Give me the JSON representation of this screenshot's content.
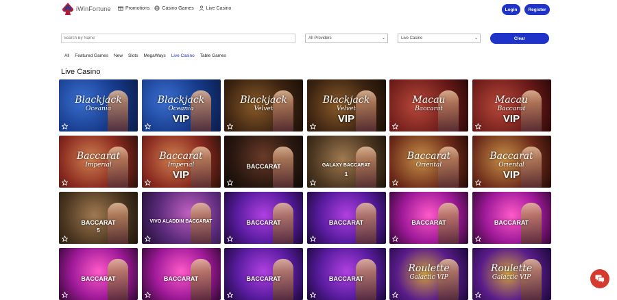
{
  "nav": {
    "logo_text": "iWinFortune",
    "links": [
      {
        "label": "Promotions",
        "icon": "gift-icon"
      },
      {
        "label": "Casino Games",
        "icon": "globe-icon"
      },
      {
        "label": "Live Casino",
        "icon": "person-icon"
      }
    ],
    "login_label": "Login",
    "register_label": "Register"
  },
  "filters": {
    "search_placeholder": "Search By Name",
    "providers_value": "All Providers",
    "category_value": "Live Casino",
    "clear_label": "Clear"
  },
  "categories": [
    "All",
    "Featured Games",
    "New",
    "Slots",
    "MegaWays",
    "Live Casino",
    "Table Games"
  ],
  "active_category": "Live Casino",
  "section_title": "Live Casino",
  "tiles": [
    {
      "title": "Blackjack",
      "sub": "Oceania",
      "vip": "",
      "theme": "blue"
    },
    {
      "title": "Blackjack",
      "sub": "Oceania",
      "vip": "VIP",
      "theme": "blue"
    },
    {
      "title": "Blackjack",
      "sub": "Velvet",
      "vip": "",
      "theme": "gold"
    },
    {
      "title": "Blackjack",
      "sub": "Velvet",
      "vip": "VIP",
      "theme": "gold"
    },
    {
      "title": "Macau",
      "sub": "Baccarat",
      "vip": "",
      "theme": "red"
    },
    {
      "title": "Macau",
      "sub": "Baccarat",
      "vip": "VIP",
      "theme": "red"
    },
    {
      "title": "Baccarat",
      "sub": "Imperial",
      "vip": "",
      "theme": "redgold"
    },
    {
      "title": "Baccarat",
      "sub": "Imperial",
      "vip": "VIP",
      "theme": "redgold"
    },
    {
      "title": "BACCARAT",
      "sub": "",
      "vip": "",
      "theme": "dark",
      "small": true
    },
    {
      "title": "GALAXY BACCARAT",
      "sub": "1",
      "vip": "",
      "theme": "brown",
      "small": true
    },
    {
      "title": "Baccarat",
      "sub": "Oriental",
      "vip": "",
      "theme": "orient"
    },
    {
      "title": "Baccarat",
      "sub": "Oriental",
      "vip": "VIP",
      "theme": "orient"
    },
    {
      "title": "BACCARAT",
      "sub": "5",
      "vip": "",
      "theme": "brown",
      "small": true
    },
    {
      "title": "VIVO ALADDIN BACCARAT",
      "sub": "",
      "vip": "",
      "theme": "violet",
      "small": true
    },
    {
      "title": "BACCARAT",
      "sub": "",
      "vip": "",
      "theme": "purple",
      "small": true
    },
    {
      "title": "BACCARAT",
      "sub": "",
      "vip": "",
      "theme": "purple",
      "small": true
    },
    {
      "title": "BACCARAT",
      "sub": "",
      "vip": "",
      "theme": "pink",
      "small": true
    },
    {
      "title": "BACCARAT",
      "sub": "",
      "vip": "",
      "theme": "pink",
      "small": true
    },
    {
      "title": "BACCARAT",
      "sub": "",
      "vip": "",
      "theme": "pink",
      "small": true
    },
    {
      "title": "BACCARAT",
      "sub": "",
      "vip": "",
      "theme": "pink",
      "small": true
    },
    {
      "title": "BACCARAT",
      "sub": "",
      "vip": "",
      "theme": "purple",
      "small": true
    },
    {
      "title": "BACCARAT",
      "sub": "",
      "vip": "",
      "theme": "purple",
      "small": true
    },
    {
      "title": "Roulette",
      "sub": "Galactic VIP",
      "vip": "",
      "theme": "violetgold"
    },
    {
      "title": "Roulette",
      "sub": "Galactic VIP",
      "vip": "",
      "theme": "violetgold"
    }
  ],
  "colors": {
    "accent": "#1f33c8",
    "chat": "#d43b2e"
  }
}
